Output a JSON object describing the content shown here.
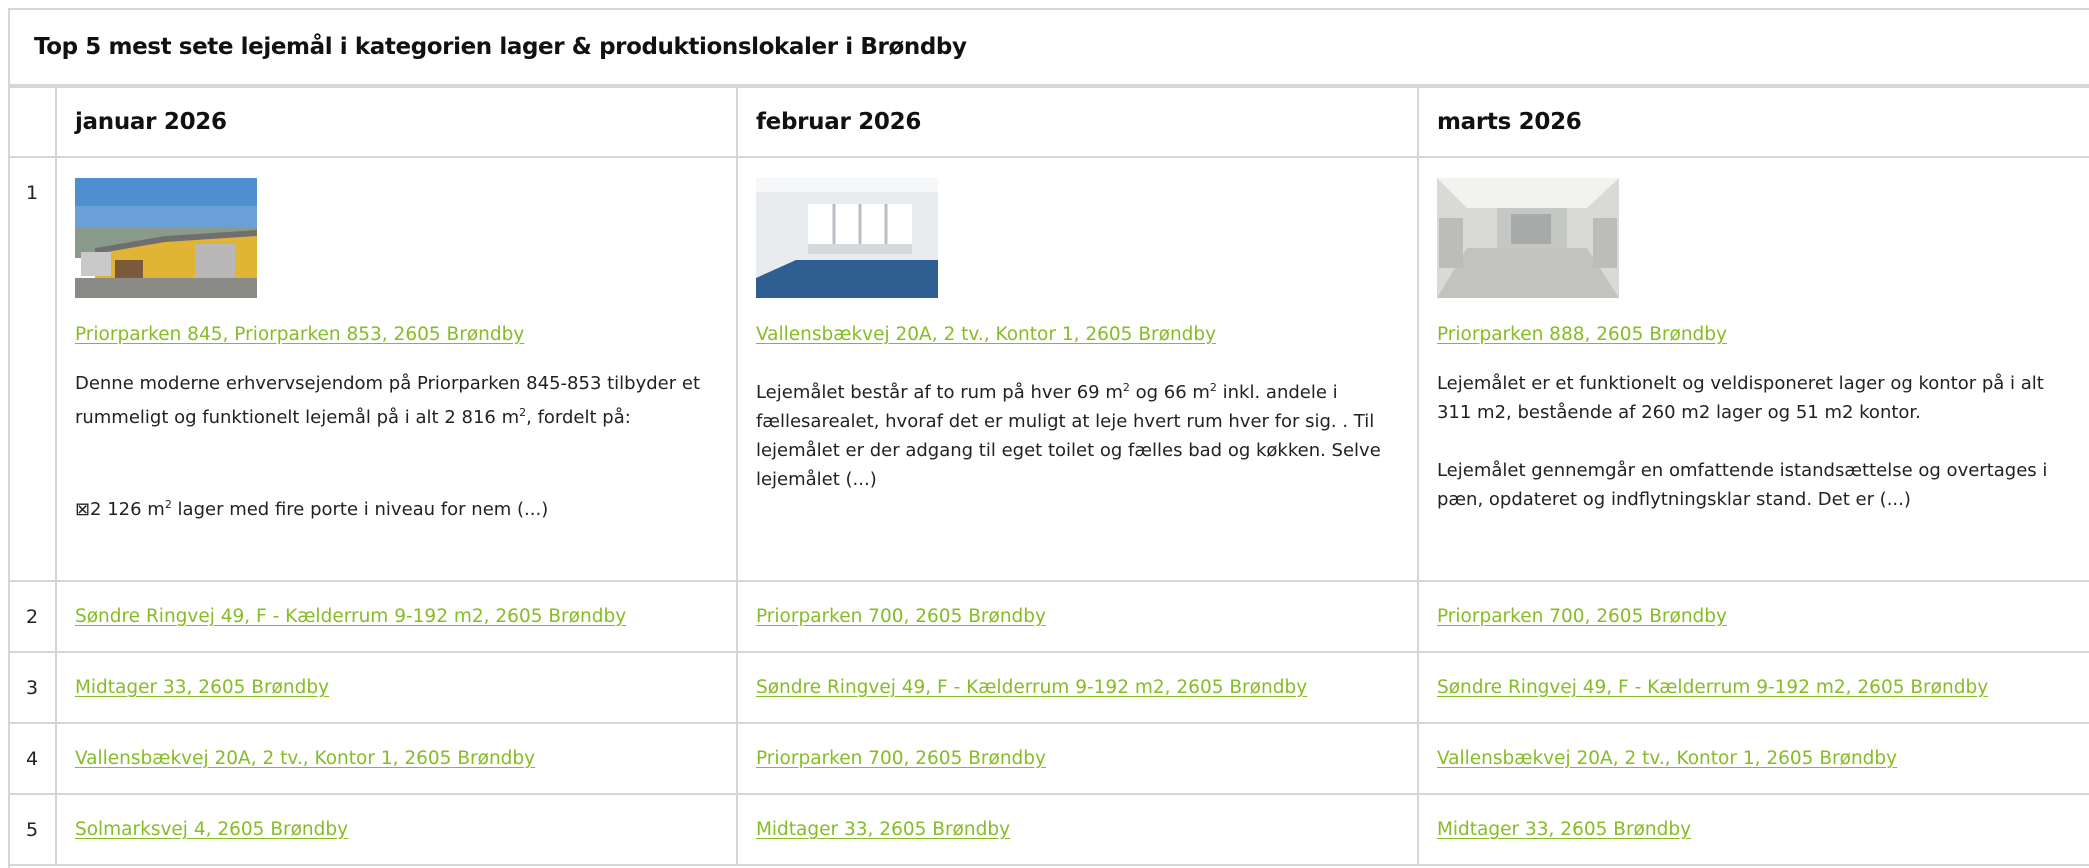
{
  "title": "Top 5 mest sete lejemål i kategorien lager & produktionslokaler i Brøndby",
  "months": [
    "januar 2026",
    "februar 2026",
    "marts 2026"
  ],
  "top": [
    {
      "link": "Priorparken 845, Priorparken 853, 2605 Brøndby",
      "image": "yellow-warehouse-photo",
      "desc_p1_a": "Denne moderne erhvervsejendom på Priorparken 845-853 tilbyder et rummeligt og funktionelt lejemål på i alt 2 816 m",
      "desc_p1_b": ", fordelt på:",
      "desc_p2_a": "⊠2 126 m",
      "desc_p2_b": " lager med fire porte i niveau for nem (...)"
    },
    {
      "link": "Vallensbækvej 20A, 2 tv., Kontor 1, 2605 Brøndby",
      "image": "office-room-photo",
      "desc_a": "Lejemålet består af to rum på hver  69 m",
      "desc_b": " og 66 m",
      "desc_c": " inkl. andele i fællesarealet, hvoraf det er muligt at leje hvert rum hver for sig. . Til lejemålet er der adgang til eget toilet og fælles bad og køkken. Selve lejemålet (...)"
    },
    {
      "link": "Priorparken 888, 2605 Brøndby",
      "image": "empty-warehouse-photo",
      "desc_p1": "Lejemålet er et funktionelt og veldisponeret lager og kontor på i alt 311 m2, bestående af 260 m2 lager og 51 m2 kontor.",
      "desc_p2": "Lejemålet gennemgår en omfattende istandsættelse og overtages i pæn, opdateret og indflytningsklar stand. Det er (...)"
    }
  ],
  "rows": [
    {
      "rank": "2",
      "cells": [
        "Søndre Ringvej 49, F - Kælderrum 9-192 m2, 2605 Brøndby",
        "Priorparken 700, 2605 Brøndby",
        "Priorparken 700, 2605 Brøndby"
      ]
    },
    {
      "rank": "3",
      "cells": [
        "Midtager 33, 2605 Brøndby",
        "Søndre Ringvej 49, F - Kælderrum 9-192 m2, 2605 Brøndby",
        "Søndre Ringvej 49, F - Kælderrum 9-192 m2, 2605 Brøndby"
      ]
    },
    {
      "rank": "4",
      "cells": [
        "Vallensbækvej 20A, 2 tv., Kontor 1, 2605 Brøndby",
        "Priorparken 700, 2605 Brøndby",
        "Vallensbækvej 20A, 2 tv., Kontor 1, 2605 Brøndby"
      ]
    },
    {
      "rank": "5",
      "cells": [
        "Solmarksvej 4, 2605 Brøndby",
        "Midtager 33, 2605 Brøndby",
        "Midtager 33, 2605 Brøndby"
      ]
    }
  ],
  "rank1": "1",
  "sup2": "2",
  "colors": {
    "link": "#86bc25",
    "border": "#d6d6d6",
    "text": "#222222"
  }
}
